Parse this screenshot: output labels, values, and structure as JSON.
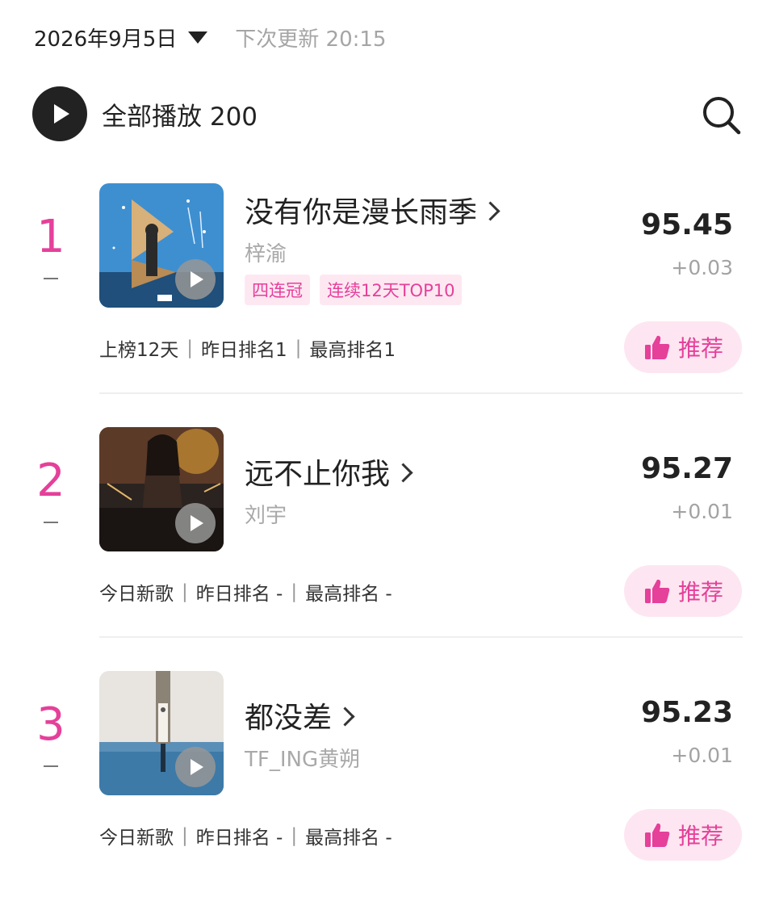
{
  "header": {
    "date": "2026年9月5日",
    "next_update": "下次更新 20:15"
  },
  "playall": {
    "label": "全部播放 200"
  },
  "icons": {
    "play": "play-icon",
    "search": "search-icon",
    "dropdown": "caret-down-icon",
    "recommend": "thumbs-up-icon",
    "chevron": "chevron-right-icon"
  },
  "colors": {
    "accent": "#e5409a",
    "accent_bg": "#fde6f1",
    "muted": "#a5a5a5"
  },
  "songs": [
    {
      "rank": "1",
      "title": "没有你是漫长雨季",
      "artist": "梓渝",
      "tags": [
        "四连冠",
        "连续12天TOP10"
      ],
      "score": "95.45",
      "delta": "+0.03",
      "meta": [
        "上榜12天",
        "昨日排名1",
        "最高排名1"
      ],
      "recommend_label": "推荐"
    },
    {
      "rank": "2",
      "title": "远不止你我",
      "artist": "刘宇",
      "tags": [],
      "score": "95.27",
      "delta": "+0.01",
      "meta": [
        "今日新歌",
        "昨日排名 -",
        "最高排名 -"
      ],
      "recommend_label": "推荐"
    },
    {
      "rank": "3",
      "title": "都没差",
      "artist": "TF_ING黄朔",
      "tags": [],
      "score": "95.23",
      "delta": "+0.01",
      "meta": [
        "今日新歌",
        "昨日排名 -",
        "最高排名 -"
      ],
      "recommend_label": "推荐"
    }
  ]
}
